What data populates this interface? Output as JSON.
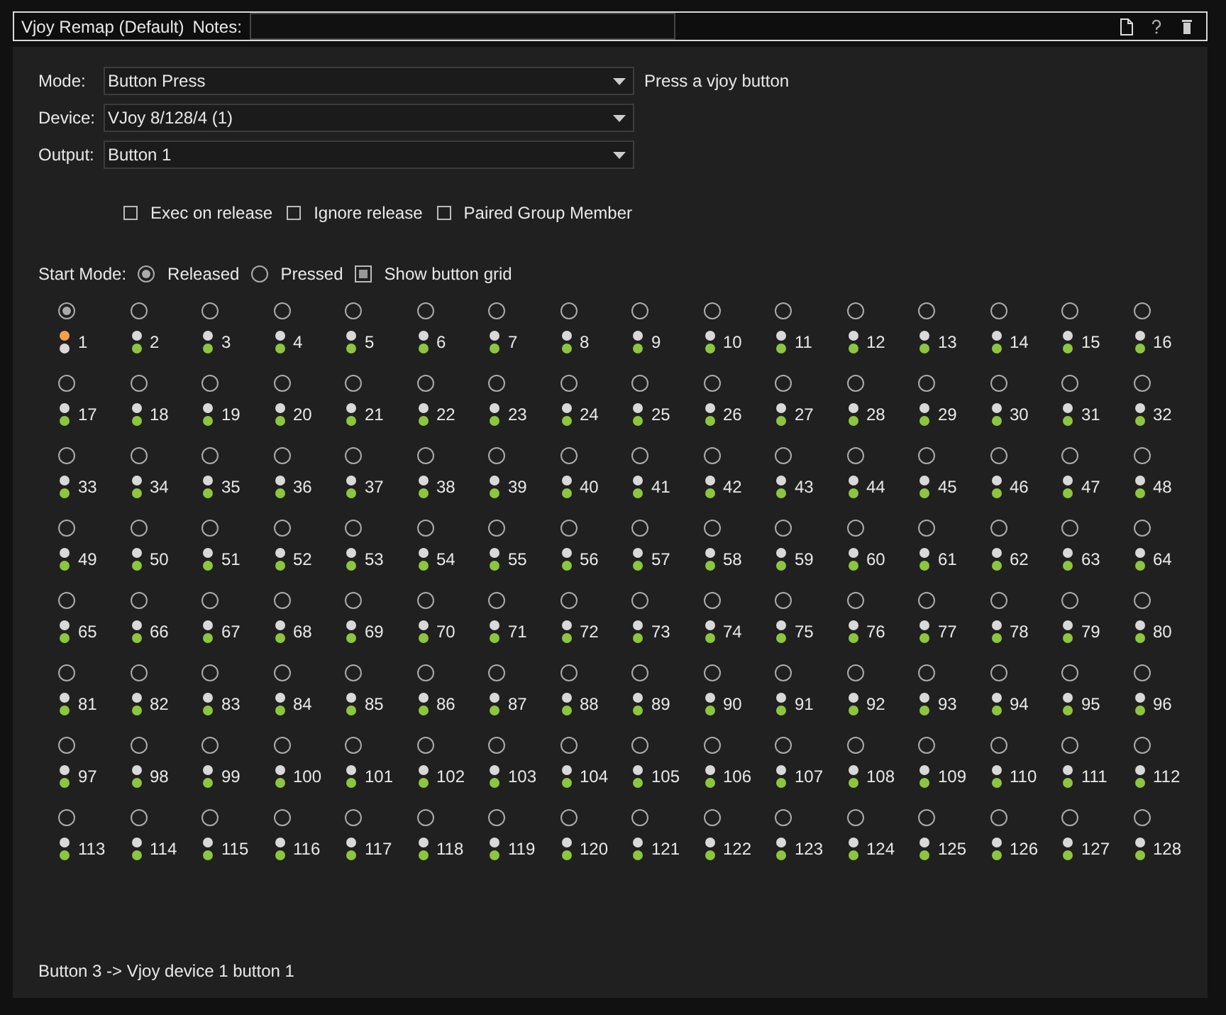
{
  "header": {
    "title": "Vjoy Remap (Default)",
    "notes_label": "Notes:"
  },
  "form": [
    {
      "label": "Mode:",
      "value": "Button Press",
      "hint": "Press a vjoy button"
    },
    {
      "label": "Device:",
      "value": "VJoy 8/128/4 (1)"
    },
    {
      "label": "Output:",
      "value": "Button 1"
    }
  ],
  "options": [
    {
      "label": "Exec on release",
      "checked": false
    },
    {
      "label": "Ignore release",
      "checked": false
    },
    {
      "label": "Paired Group Member",
      "checked": false
    }
  ],
  "start_mode": {
    "label": "Start Mode:",
    "choices": [
      {
        "label": "Released",
        "selected": true
      },
      {
        "label": "Pressed",
        "selected": false
      }
    ],
    "grid_toggle": {
      "label": "Show button grid",
      "checked": true
    }
  },
  "buttons": [
    {
      "label": "1",
      "selected": true,
      "dots": [
        {
          "color": "#f5a04a"
        },
        {
          "color": "#d9d9d9"
        }
      ]
    },
    {
      "label": "2",
      "selected": false,
      "dots": [
        {
          "color": "#d9d9d9"
        },
        {
          "color": "#8cc63f"
        }
      ]
    },
    {
      "label": "3",
      "selected": false,
      "dots": [
        {
          "color": "#d9d9d9"
        },
        {
          "color": "#8cc63f"
        }
      ]
    },
    {
      "label": "4",
      "selected": false,
      "dots": [
        {
          "color": "#d9d9d9"
        },
        {
          "color": "#8cc63f"
        }
      ]
    },
    {
      "label": "5",
      "selected": false,
      "dots": [
        {
          "color": "#d9d9d9"
        },
        {
          "color": "#8cc63f"
        }
      ]
    },
    {
      "label": "6",
      "selected": false,
      "dots": [
        {
          "color": "#d9d9d9"
        },
        {
          "color": "#8cc63f"
        }
      ]
    },
    {
      "label": "7",
      "selected": false,
      "dots": [
        {
          "color": "#d9d9d9"
        },
        {
          "color": "#8cc63f"
        }
      ]
    },
    {
      "label": "8",
      "selected": false,
      "dots": [
        {
          "color": "#d9d9d9"
        },
        {
          "color": "#8cc63f"
        }
      ]
    },
    {
      "label": "9",
      "selected": false,
      "dots": [
        {
          "color": "#d9d9d9"
        },
        {
          "color": "#8cc63f"
        }
      ]
    },
    {
      "label": "10",
      "selected": false,
      "dots": [
        {
          "color": "#d9d9d9"
        },
        {
          "color": "#8cc63f"
        }
      ]
    },
    {
      "label": "11",
      "selected": false,
      "dots": [
        {
          "color": "#d9d9d9"
        },
        {
          "color": "#8cc63f"
        }
      ]
    },
    {
      "label": "12",
      "selected": false,
      "dots": [
        {
          "color": "#d9d9d9"
        },
        {
          "color": "#8cc63f"
        }
      ]
    },
    {
      "label": "13",
      "selected": false,
      "dots": [
        {
          "color": "#d9d9d9"
        },
        {
          "color": "#8cc63f"
        }
      ]
    },
    {
      "label": "14",
      "selected": false,
      "dots": [
        {
          "color": "#d9d9d9"
        },
        {
          "color": "#8cc63f"
        }
      ]
    },
    {
      "label": "15",
      "selected": false,
      "dots": [
        {
          "color": "#d9d9d9"
        },
        {
          "color": "#8cc63f"
        }
      ]
    },
    {
      "label": "16",
      "selected": false,
      "dots": [
        {
          "color": "#d9d9d9"
        },
        {
          "color": "#8cc63f"
        }
      ]
    },
    {
      "label": "17",
      "selected": false,
      "dots": [
        {
          "color": "#d9d9d9"
        },
        {
          "color": "#8cc63f"
        }
      ]
    },
    {
      "label": "18",
      "selected": false,
      "dots": [
        {
          "color": "#d9d9d9"
        },
        {
          "color": "#8cc63f"
        }
      ]
    },
    {
      "label": "19",
      "selected": false,
      "dots": [
        {
          "color": "#d9d9d9"
        },
        {
          "color": "#8cc63f"
        }
      ]
    },
    {
      "label": "20",
      "selected": false,
      "dots": [
        {
          "color": "#d9d9d9"
        },
        {
          "color": "#8cc63f"
        }
      ]
    },
    {
      "label": "21",
      "selected": false,
      "dots": [
        {
          "color": "#d9d9d9"
        },
        {
          "color": "#8cc63f"
        }
      ]
    },
    {
      "label": "22",
      "selected": false,
      "dots": [
        {
          "color": "#d9d9d9"
        },
        {
          "color": "#8cc63f"
        }
      ]
    },
    {
      "label": "23",
      "selected": false,
      "dots": [
        {
          "color": "#d9d9d9"
        },
        {
          "color": "#8cc63f"
        }
      ]
    },
    {
      "label": "24",
      "selected": false,
      "dots": [
        {
          "color": "#d9d9d9"
        },
        {
          "color": "#8cc63f"
        }
      ]
    },
    {
      "label": "25",
      "selected": false,
      "dots": [
        {
          "color": "#d9d9d9"
        },
        {
          "color": "#8cc63f"
        }
      ]
    },
    {
      "label": "26",
      "selected": false,
      "dots": [
        {
          "color": "#d9d9d9"
        },
        {
          "color": "#8cc63f"
        }
      ]
    },
    {
      "label": "27",
      "selected": false,
      "dots": [
        {
          "color": "#d9d9d9"
        },
        {
          "color": "#8cc63f"
        }
      ]
    },
    {
      "label": "28",
      "selected": false,
      "dots": [
        {
          "color": "#d9d9d9"
        },
        {
          "color": "#8cc63f"
        }
      ]
    },
    {
      "label": "29",
      "selected": false,
      "dots": [
        {
          "color": "#d9d9d9"
        },
        {
          "color": "#8cc63f"
        }
      ]
    },
    {
      "label": "30",
      "selected": false,
      "dots": [
        {
          "color": "#d9d9d9"
        },
        {
          "color": "#8cc63f"
        }
      ]
    },
    {
      "label": "31",
      "selected": false,
      "dots": [
        {
          "color": "#d9d9d9"
        },
        {
          "color": "#8cc63f"
        }
      ]
    },
    {
      "label": "32",
      "selected": false,
      "dots": [
        {
          "color": "#d9d9d9"
        },
        {
          "color": "#8cc63f"
        }
      ]
    },
    {
      "label": "33",
      "selected": false,
      "dots": [
        {
          "color": "#d9d9d9"
        },
        {
          "color": "#8cc63f"
        }
      ]
    },
    {
      "label": "34",
      "selected": false,
      "dots": [
        {
          "color": "#d9d9d9"
        },
        {
          "color": "#8cc63f"
        }
      ]
    },
    {
      "label": "35",
      "selected": false,
      "dots": [
        {
          "color": "#d9d9d9"
        },
        {
          "color": "#8cc63f"
        }
      ]
    },
    {
      "label": "36",
      "selected": false,
      "dots": [
        {
          "color": "#d9d9d9"
        },
        {
          "color": "#8cc63f"
        }
      ]
    },
    {
      "label": "37",
      "selected": false,
      "dots": [
        {
          "color": "#d9d9d9"
        },
        {
          "color": "#8cc63f"
        }
      ]
    },
    {
      "label": "38",
      "selected": false,
      "dots": [
        {
          "color": "#d9d9d9"
        },
        {
          "color": "#8cc63f"
        }
      ]
    },
    {
      "label": "39",
      "selected": false,
      "dots": [
        {
          "color": "#d9d9d9"
        },
        {
          "color": "#8cc63f"
        }
      ]
    },
    {
      "label": "40",
      "selected": false,
      "dots": [
        {
          "color": "#d9d9d9"
        },
        {
          "color": "#8cc63f"
        }
      ]
    },
    {
      "label": "41",
      "selected": false,
      "dots": [
        {
          "color": "#d9d9d9"
        },
        {
          "color": "#8cc63f"
        }
      ]
    },
    {
      "label": "42",
      "selected": false,
      "dots": [
        {
          "color": "#d9d9d9"
        },
        {
          "color": "#8cc63f"
        }
      ]
    },
    {
      "label": "43",
      "selected": false,
      "dots": [
        {
          "color": "#d9d9d9"
        },
        {
          "color": "#8cc63f"
        }
      ]
    },
    {
      "label": "44",
      "selected": false,
      "dots": [
        {
          "color": "#d9d9d9"
        },
        {
          "color": "#8cc63f"
        }
      ]
    },
    {
      "label": "45",
      "selected": false,
      "dots": [
        {
          "color": "#d9d9d9"
        },
        {
          "color": "#8cc63f"
        }
      ]
    },
    {
      "label": "46",
      "selected": false,
      "dots": [
        {
          "color": "#d9d9d9"
        },
        {
          "color": "#8cc63f"
        }
      ]
    },
    {
      "label": "47",
      "selected": false,
      "dots": [
        {
          "color": "#d9d9d9"
        },
        {
          "color": "#8cc63f"
        }
      ]
    },
    {
      "label": "48",
      "selected": false,
      "dots": [
        {
          "color": "#d9d9d9"
        },
        {
          "color": "#8cc63f"
        }
      ]
    },
    {
      "label": "49",
      "selected": false,
      "dots": [
        {
          "color": "#d9d9d9"
        },
        {
          "color": "#8cc63f"
        }
      ]
    },
    {
      "label": "50",
      "selected": false,
      "dots": [
        {
          "color": "#d9d9d9"
        },
        {
          "color": "#8cc63f"
        }
      ]
    },
    {
      "label": "51",
      "selected": false,
      "dots": [
        {
          "color": "#d9d9d9"
        },
        {
          "color": "#8cc63f"
        }
      ]
    },
    {
      "label": "52",
      "selected": false,
      "dots": [
        {
          "color": "#d9d9d9"
        },
        {
          "color": "#8cc63f"
        }
      ]
    },
    {
      "label": "53",
      "selected": false,
      "dots": [
        {
          "color": "#d9d9d9"
        },
        {
          "color": "#8cc63f"
        }
      ]
    },
    {
      "label": "54",
      "selected": false,
      "dots": [
        {
          "color": "#d9d9d9"
        },
        {
          "color": "#8cc63f"
        }
      ]
    },
    {
      "label": "55",
      "selected": false,
      "dots": [
        {
          "color": "#d9d9d9"
        },
        {
          "color": "#8cc63f"
        }
      ]
    },
    {
      "label": "56",
      "selected": false,
      "dots": [
        {
          "color": "#d9d9d9"
        },
        {
          "color": "#8cc63f"
        }
      ]
    },
    {
      "label": "57",
      "selected": false,
      "dots": [
        {
          "color": "#d9d9d9"
        },
        {
          "color": "#8cc63f"
        }
      ]
    },
    {
      "label": "58",
      "selected": false,
      "dots": [
        {
          "color": "#d9d9d9"
        },
        {
          "color": "#8cc63f"
        }
      ]
    },
    {
      "label": "59",
      "selected": false,
      "dots": [
        {
          "color": "#d9d9d9"
        },
        {
          "color": "#8cc63f"
        }
      ]
    },
    {
      "label": "60",
      "selected": false,
      "dots": [
        {
          "color": "#d9d9d9"
        },
        {
          "color": "#8cc63f"
        }
      ]
    },
    {
      "label": "61",
      "selected": false,
      "dots": [
        {
          "color": "#d9d9d9"
        },
        {
          "color": "#8cc63f"
        }
      ]
    },
    {
      "label": "62",
      "selected": false,
      "dots": [
        {
          "color": "#d9d9d9"
        },
        {
          "color": "#8cc63f"
        }
      ]
    },
    {
      "label": "63",
      "selected": false,
      "dots": [
        {
          "color": "#d9d9d9"
        },
        {
          "color": "#8cc63f"
        }
      ]
    },
    {
      "label": "64",
      "selected": false,
      "dots": [
        {
          "color": "#d9d9d9"
        },
        {
          "color": "#8cc63f"
        }
      ]
    },
    {
      "label": "65",
      "selected": false,
      "dots": [
        {
          "color": "#d9d9d9"
        },
        {
          "color": "#8cc63f"
        }
      ]
    },
    {
      "label": "66",
      "selected": false,
      "dots": [
        {
          "color": "#d9d9d9"
        },
        {
          "color": "#8cc63f"
        }
      ]
    },
    {
      "label": "67",
      "selected": false,
      "dots": [
        {
          "color": "#d9d9d9"
        },
        {
          "color": "#8cc63f"
        }
      ]
    },
    {
      "label": "68",
      "selected": false,
      "dots": [
        {
          "color": "#d9d9d9"
        },
        {
          "color": "#8cc63f"
        }
      ]
    },
    {
      "label": "69",
      "selected": false,
      "dots": [
        {
          "color": "#d9d9d9"
        },
        {
          "color": "#8cc63f"
        }
      ]
    },
    {
      "label": "70",
      "selected": false,
      "dots": [
        {
          "color": "#d9d9d9"
        },
        {
          "color": "#8cc63f"
        }
      ]
    },
    {
      "label": "71",
      "selected": false,
      "dots": [
        {
          "color": "#d9d9d9"
        },
        {
          "color": "#8cc63f"
        }
      ]
    },
    {
      "label": "72",
      "selected": false,
      "dots": [
        {
          "color": "#d9d9d9"
        },
        {
          "color": "#8cc63f"
        }
      ]
    },
    {
      "label": "73",
      "selected": false,
      "dots": [
        {
          "color": "#d9d9d9"
        },
        {
          "color": "#8cc63f"
        }
      ]
    },
    {
      "label": "74",
      "selected": false,
      "dots": [
        {
          "color": "#d9d9d9"
        },
        {
          "color": "#8cc63f"
        }
      ]
    },
    {
      "label": "75",
      "selected": false,
      "dots": [
        {
          "color": "#d9d9d9"
        },
        {
          "color": "#8cc63f"
        }
      ]
    },
    {
      "label": "76",
      "selected": false,
      "dots": [
        {
          "color": "#d9d9d9"
        },
        {
          "color": "#8cc63f"
        }
      ]
    },
    {
      "label": "77",
      "selected": false,
      "dots": [
        {
          "color": "#d9d9d9"
        },
        {
          "color": "#8cc63f"
        }
      ]
    },
    {
      "label": "78",
      "selected": false,
      "dots": [
        {
          "color": "#d9d9d9"
        },
        {
          "color": "#8cc63f"
        }
      ]
    },
    {
      "label": "79",
      "selected": false,
      "dots": [
        {
          "color": "#d9d9d9"
        },
        {
          "color": "#8cc63f"
        }
      ]
    },
    {
      "label": "80",
      "selected": false,
      "dots": [
        {
          "color": "#d9d9d9"
        },
        {
          "color": "#8cc63f"
        }
      ]
    },
    {
      "label": "81",
      "selected": false,
      "dots": [
        {
          "color": "#d9d9d9"
        },
        {
          "color": "#8cc63f"
        }
      ]
    },
    {
      "label": "82",
      "selected": false,
      "dots": [
        {
          "color": "#d9d9d9"
        },
        {
          "color": "#8cc63f"
        }
      ]
    },
    {
      "label": "83",
      "selected": false,
      "dots": [
        {
          "color": "#d9d9d9"
        },
        {
          "color": "#8cc63f"
        }
      ]
    },
    {
      "label": "84",
      "selected": false,
      "dots": [
        {
          "color": "#d9d9d9"
        },
        {
          "color": "#8cc63f"
        }
      ]
    },
    {
      "label": "85",
      "selected": false,
      "dots": [
        {
          "color": "#d9d9d9"
        },
        {
          "color": "#8cc63f"
        }
      ]
    },
    {
      "label": "86",
      "selected": false,
      "dots": [
        {
          "color": "#d9d9d9"
        },
        {
          "color": "#8cc63f"
        }
      ]
    },
    {
      "label": "87",
      "selected": false,
      "dots": [
        {
          "color": "#d9d9d9"
        },
        {
          "color": "#8cc63f"
        }
      ]
    },
    {
      "label": "88",
      "selected": false,
      "dots": [
        {
          "color": "#d9d9d9"
        },
        {
          "color": "#8cc63f"
        }
      ]
    },
    {
      "label": "89",
      "selected": false,
      "dots": [
        {
          "color": "#d9d9d9"
        },
        {
          "color": "#8cc63f"
        }
      ]
    },
    {
      "label": "90",
      "selected": false,
      "dots": [
        {
          "color": "#d9d9d9"
        },
        {
          "color": "#8cc63f"
        }
      ]
    },
    {
      "label": "91",
      "selected": false,
      "dots": [
        {
          "color": "#d9d9d9"
        },
        {
          "color": "#8cc63f"
        }
      ]
    },
    {
      "label": "92",
      "selected": false,
      "dots": [
        {
          "color": "#d9d9d9"
        },
        {
          "color": "#8cc63f"
        }
      ]
    },
    {
      "label": "93",
      "selected": false,
      "dots": [
        {
          "color": "#d9d9d9"
        },
        {
          "color": "#8cc63f"
        }
      ]
    },
    {
      "label": "94",
      "selected": false,
      "dots": [
        {
          "color": "#d9d9d9"
        },
        {
          "color": "#8cc63f"
        }
      ]
    },
    {
      "label": "95",
      "selected": false,
      "dots": [
        {
          "color": "#d9d9d9"
        },
        {
          "color": "#8cc63f"
        }
      ]
    },
    {
      "label": "96",
      "selected": false,
      "dots": [
        {
          "color": "#d9d9d9"
        },
        {
          "color": "#8cc63f"
        }
      ]
    },
    {
      "label": "97",
      "selected": false,
      "dots": [
        {
          "color": "#d9d9d9"
        },
        {
          "color": "#8cc63f"
        }
      ]
    },
    {
      "label": "98",
      "selected": false,
      "dots": [
        {
          "color": "#d9d9d9"
        },
        {
          "color": "#8cc63f"
        }
      ]
    },
    {
      "label": "99",
      "selected": false,
      "dots": [
        {
          "color": "#d9d9d9"
        },
        {
          "color": "#8cc63f"
        }
      ]
    },
    {
      "label": "100",
      "selected": false,
      "dots": [
        {
          "color": "#d9d9d9"
        },
        {
          "color": "#8cc63f"
        }
      ]
    },
    {
      "label": "101",
      "selected": false,
      "dots": [
        {
          "color": "#d9d9d9"
        },
        {
          "color": "#8cc63f"
        }
      ]
    },
    {
      "label": "102",
      "selected": false,
      "dots": [
        {
          "color": "#d9d9d9"
        },
        {
          "color": "#8cc63f"
        }
      ]
    },
    {
      "label": "103",
      "selected": false,
      "dots": [
        {
          "color": "#d9d9d9"
        },
        {
          "color": "#8cc63f"
        }
      ]
    },
    {
      "label": "104",
      "selected": false,
      "dots": [
        {
          "color": "#d9d9d9"
        },
        {
          "color": "#8cc63f"
        }
      ]
    },
    {
      "label": "105",
      "selected": false,
      "dots": [
        {
          "color": "#d9d9d9"
        },
        {
          "color": "#8cc63f"
        }
      ]
    },
    {
      "label": "106",
      "selected": false,
      "dots": [
        {
          "color": "#d9d9d9"
        },
        {
          "color": "#8cc63f"
        }
      ]
    },
    {
      "label": "107",
      "selected": false,
      "dots": [
        {
          "color": "#d9d9d9"
        },
        {
          "color": "#8cc63f"
        }
      ]
    },
    {
      "label": "108",
      "selected": false,
      "dots": [
        {
          "color": "#d9d9d9"
        },
        {
          "color": "#8cc63f"
        }
      ]
    },
    {
      "label": "109",
      "selected": false,
      "dots": [
        {
          "color": "#d9d9d9"
        },
        {
          "color": "#8cc63f"
        }
      ]
    },
    {
      "label": "110",
      "selected": false,
      "dots": [
        {
          "color": "#d9d9d9"
        },
        {
          "color": "#8cc63f"
        }
      ]
    },
    {
      "label": "111",
      "selected": false,
      "dots": [
        {
          "color": "#d9d9d9"
        },
        {
          "color": "#8cc63f"
        }
      ]
    },
    {
      "label": "112",
      "selected": false,
      "dots": [
        {
          "color": "#d9d9d9"
        },
        {
          "color": "#8cc63f"
        }
      ]
    },
    {
      "label": "113",
      "selected": false,
      "dots": [
        {
          "color": "#d9d9d9"
        },
        {
          "color": "#8cc63f"
        }
      ]
    },
    {
      "label": "114",
      "selected": false,
      "dots": [
        {
          "color": "#d9d9d9"
        },
        {
          "color": "#8cc63f"
        }
      ]
    },
    {
      "label": "115",
      "selected": false,
      "dots": [
        {
          "color": "#d9d9d9"
        },
        {
          "color": "#8cc63f"
        }
      ]
    },
    {
      "label": "116",
      "selected": false,
      "dots": [
        {
          "color": "#d9d9d9"
        },
        {
          "color": "#8cc63f"
        }
      ]
    },
    {
      "label": "117",
      "selected": false,
      "dots": [
        {
          "color": "#d9d9d9"
        },
        {
          "color": "#8cc63f"
        }
      ]
    },
    {
      "label": "118",
      "selected": false,
      "dots": [
        {
          "color": "#d9d9d9"
        },
        {
          "color": "#8cc63f"
        }
      ]
    },
    {
      "label": "119",
      "selected": false,
      "dots": [
        {
          "color": "#d9d9d9"
        },
        {
          "color": "#8cc63f"
        }
      ]
    },
    {
      "label": "120",
      "selected": false,
      "dots": [
        {
          "color": "#d9d9d9"
        },
        {
          "color": "#8cc63f"
        }
      ]
    },
    {
      "label": "121",
      "selected": false,
      "dots": [
        {
          "color": "#d9d9d9"
        },
        {
          "color": "#8cc63f"
        }
      ]
    },
    {
      "label": "122",
      "selected": false,
      "dots": [
        {
          "color": "#d9d9d9"
        },
        {
          "color": "#8cc63f"
        }
      ]
    },
    {
      "label": "123",
      "selected": false,
      "dots": [
        {
          "color": "#d9d9d9"
        },
        {
          "color": "#8cc63f"
        }
      ]
    },
    {
      "label": "124",
      "selected": false,
      "dots": [
        {
          "color": "#d9d9d9"
        },
        {
          "color": "#8cc63f"
        }
      ]
    },
    {
      "label": "125",
      "selected": false,
      "dots": [
        {
          "color": "#d9d9d9"
        },
        {
          "color": "#8cc63f"
        }
      ]
    },
    {
      "label": "126",
      "selected": false,
      "dots": [
        {
          "color": "#d9d9d9"
        },
        {
          "color": "#8cc63f"
        }
      ]
    },
    {
      "label": "127",
      "selected": false,
      "dots": [
        {
          "color": "#d9d9d9"
        },
        {
          "color": "#8cc63f"
        }
      ]
    },
    {
      "label": "128",
      "selected": false,
      "dots": [
        {
          "color": "#d9d9d9"
        },
        {
          "color": "#8cc63f"
        }
      ]
    }
  ],
  "footer": "Button 3 -> Vjoy device 1 button 1"
}
